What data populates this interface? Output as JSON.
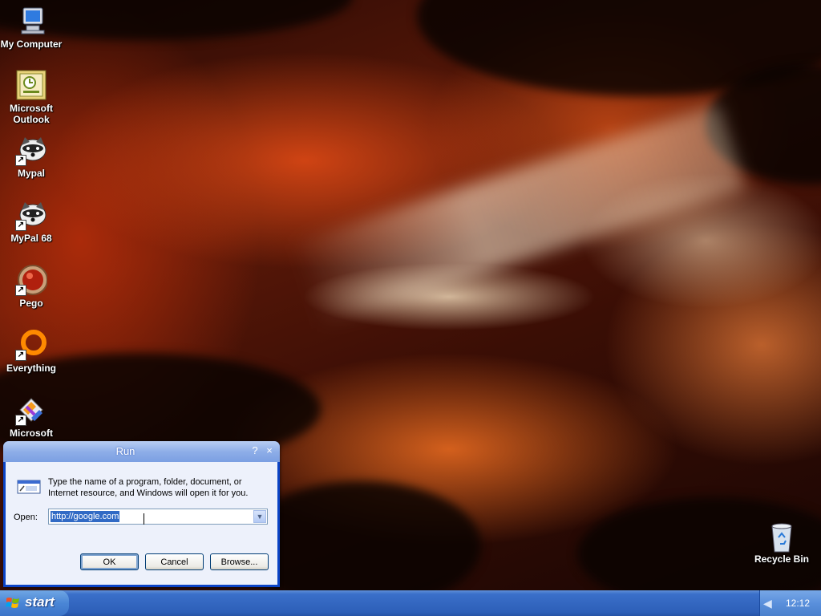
{
  "desktop": {
    "icons": [
      {
        "label": "My Computer",
        "icon": "my-computer-icon"
      },
      {
        "label": "Microsoft Outlook",
        "icon": "outlook-icon"
      },
      {
        "label": "Mypal",
        "icon": "mypal-icon"
      },
      {
        "label": "MyPal 68",
        "icon": "mypal68-icon"
      },
      {
        "label": "Pego",
        "icon": "pego-icon"
      },
      {
        "label": "Everything",
        "icon": "everything-icon"
      },
      {
        "label": "Microsoft",
        "icon": "visual-studio-icon"
      },
      {
        "label": "Recycle Bin",
        "icon": "recycle-bin-icon"
      }
    ]
  },
  "run_dialog": {
    "title": "Run",
    "help_glyph": "?",
    "close_glyph": "×",
    "description": "Type the name of a program, folder, document, or Internet resource, and Windows will open it for you.",
    "open_label": "Open:",
    "open_value": "http://google.com",
    "ok_label": "OK",
    "cancel_label": "Cancel",
    "browse_label": "Browse..."
  },
  "taskbar": {
    "start_label": "start",
    "clock": "12:12"
  },
  "colors": {
    "taskbar_blue": "#2d5fb8",
    "start_green": "#3c74c8",
    "title_blue": "#8eaee8",
    "selection": "#316ac5"
  }
}
